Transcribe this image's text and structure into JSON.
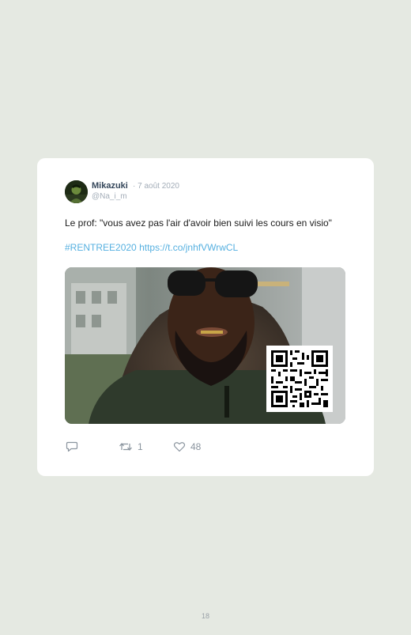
{
  "tweet": {
    "author_name": "Mikazuki",
    "date": "· 7 août 2020",
    "handle": "@Na_i_m",
    "text": "Le prof: \"vous avez pas l'air d'avoir bien suivi les cours en visio\"",
    "hashtag": "#RENTREE2020",
    "link": "https://t.co/jnhfVWrwCL",
    "media_icon": "video-thumbnail-with-qr-code"
  },
  "actions": {
    "reply_icon": "reply-icon",
    "reply_count": "",
    "retweet_icon": "retweet-icon",
    "retweet_count": "1",
    "like_icon": "heart-icon",
    "like_count": "48"
  },
  "page": {
    "number": "18"
  }
}
